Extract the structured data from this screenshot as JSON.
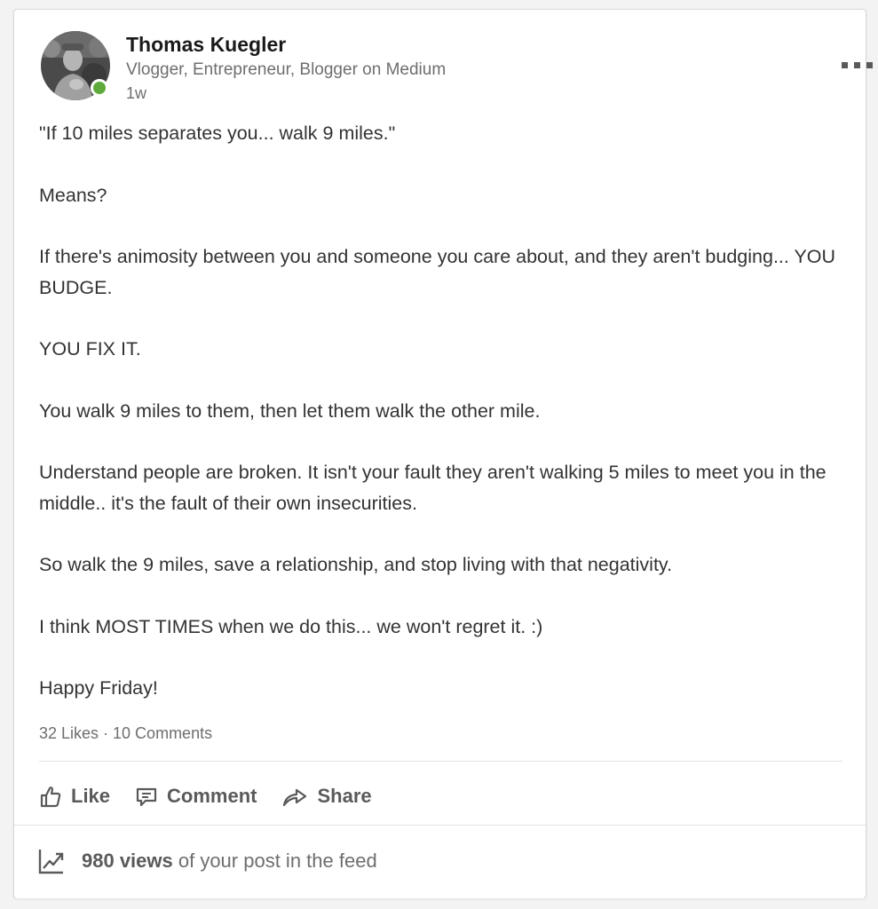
{
  "post": {
    "author": {
      "name": "Thomas Kuegler",
      "headline": "Vlogger, Entrepreneur, Blogger on Medium",
      "time": "1w",
      "presence_color": "#5eaa3a"
    },
    "paragraphs": [
      "\"If 10 miles separates you... walk 9 miles.\"",
      "Means?",
      "If there's animosity between you and someone you care about, and they aren't budging... YOU BUDGE.",
      "YOU FIX IT.",
      "You walk 9 miles to them, then let them walk the other mile.",
      "Understand people are broken. It isn't your fault they aren't walking 5 miles to meet you in the middle.. it's the fault of their own insecurities.",
      "So walk the 9 miles, save a relationship, and stop living with that negativity.",
      "I think MOST TIMES when we do this... we won't regret it. :)",
      "Happy Friday!"
    ],
    "social": {
      "counts_text": "32 Likes · 10 Comments"
    },
    "actions": {
      "like_label": "Like",
      "like_icon": "thumbs-up-icon",
      "comment_label": "Comment",
      "comment_icon": "comment-icon",
      "share_label": "Share",
      "share_icon": "share-arrow-icon"
    },
    "analytics": {
      "views": "980 views",
      "views_suffix": " of your post in the feed",
      "icon": "trending-chart-icon"
    },
    "more_icon": "more-options-icon"
  }
}
